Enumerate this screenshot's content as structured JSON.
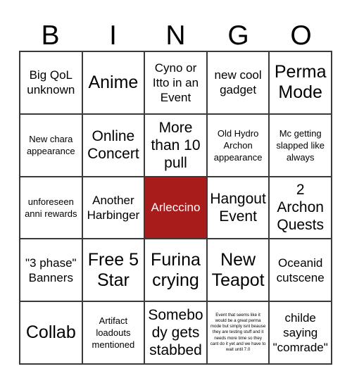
{
  "card": {
    "title_letters": [
      "B",
      "I",
      "N",
      "G",
      "O"
    ],
    "marked_color": "#a81c1c",
    "marked_text_color": "#ffffff",
    "grid_line_color": "#3a3a3a",
    "background_color": "#ffffff",
    "text_color": "#000000",
    "rows": 5,
    "columns": 5,
    "cells": [
      {
        "text": "Big QoL unknown",
        "size": "md",
        "marked": false
      },
      {
        "text": "Anime",
        "size": "xl",
        "marked": false
      },
      {
        "text": "Cyno or Itto in an Event",
        "size": "md",
        "marked": false
      },
      {
        "text": "new cool gadget",
        "size": "md",
        "marked": false
      },
      {
        "text": "Perma Mode",
        "size": "xl",
        "marked": false
      },
      {
        "text": "New chara appearance",
        "size": "sm",
        "marked": false
      },
      {
        "text": "Online Concert",
        "size": "lg",
        "marked": false
      },
      {
        "text": "More than 10 pull",
        "size": "lg",
        "marked": false
      },
      {
        "text": "Old Hydro Archon appearance",
        "size": "sm",
        "marked": false
      },
      {
        "text": "Mc getting slapped like always",
        "size": "sm",
        "marked": false
      },
      {
        "text": "unforeseen anni rewards",
        "size": "sm",
        "marked": false
      },
      {
        "text": "Another Harbinger",
        "size": "md",
        "marked": false
      },
      {
        "text": "Arleccino",
        "size": "md",
        "marked": true
      },
      {
        "text": "Hangout Event",
        "size": "lg",
        "marked": false
      },
      {
        "text": "2 Archon Quests",
        "size": "lg",
        "marked": false
      },
      {
        "text": "\"3 phase\" Banners",
        "size": "md",
        "marked": false
      },
      {
        "text": "Free 5 Star",
        "size": "xl",
        "marked": false
      },
      {
        "text": "Furina crying",
        "size": "xl",
        "marked": false
      },
      {
        "text": "New Teapot",
        "size": "xl",
        "marked": false
      },
      {
        "text": "Oceanid cutscene",
        "size": "md",
        "marked": false
      },
      {
        "text": "Collab",
        "size": "xl",
        "marked": false
      },
      {
        "text": "Artifact loadouts mentioned",
        "size": "sm",
        "marked": false
      },
      {
        "text": "Somebody gets stabbed",
        "size": "lg",
        "marked": false
      },
      {
        "text": "Event that seems like it would be a great perma mode but simply isnt beause they are testing stuff and it needs more time so they cant do it yet and we have to wait until 7.0",
        "size": "tiny",
        "marked": false
      },
      {
        "text": "childe saying \"comrade\"",
        "size": "md",
        "marked": false
      }
    ]
  }
}
